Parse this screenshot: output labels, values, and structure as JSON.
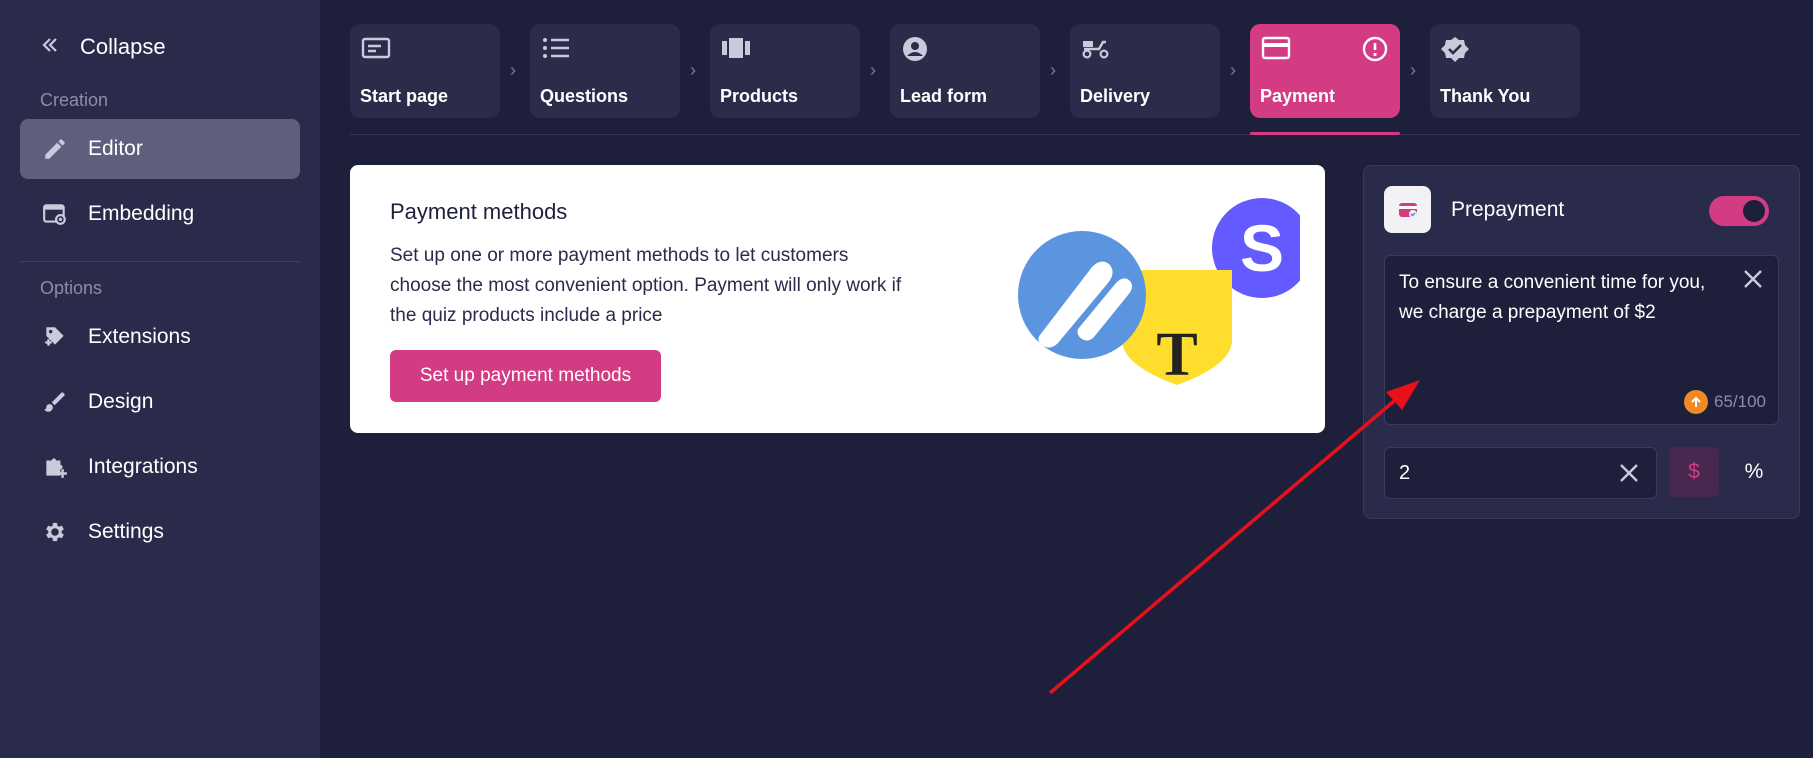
{
  "sidebar": {
    "collapse_label": "Collapse",
    "creation_label": "Creation",
    "options_label": "Options",
    "creation_items": [
      {
        "label": "Editor",
        "icon": "pencil-icon"
      },
      {
        "label": "Embedding",
        "icon": "embed-icon"
      }
    ],
    "options_items": [
      {
        "label": "Extensions",
        "icon": "puzzle-icon"
      },
      {
        "label": "Design",
        "icon": "brush-icon"
      },
      {
        "label": "Integrations",
        "icon": "integrations-icon"
      },
      {
        "label": "Settings",
        "icon": "gear-icon"
      }
    ]
  },
  "steps": [
    {
      "label": "Start page",
      "icon": "start-page-icon"
    },
    {
      "label": "Questions",
      "icon": "list-icon"
    },
    {
      "label": "Products",
      "icon": "carousel-icon"
    },
    {
      "label": "Lead form",
      "icon": "user-circle-icon"
    },
    {
      "label": "Delivery",
      "icon": "scooter-icon"
    },
    {
      "label": "Payment",
      "icon": "credit-card-icon",
      "active": true
    },
    {
      "label": "Thank You",
      "icon": "verified-badge-icon"
    }
  ],
  "payment_card": {
    "title": "Payment methods",
    "description": "Set up one or more payment methods to let customers choose the most convenient option. Payment will only work if the quiz products include a price",
    "button_label": "Set up payment methods"
  },
  "prepayment": {
    "title": "Prepayment",
    "enabled": true,
    "message": "To ensure a convenient time for you, we charge a prepayment of $2",
    "counter": "65/100",
    "amount": "2",
    "currency_symbol": "$",
    "percent_symbol": "%"
  },
  "colors": {
    "accent": "#d33b83",
    "background": "#1e1f3b",
    "sidebar": "#2a2b4a",
    "annotation_arrow": "#e8101a"
  }
}
